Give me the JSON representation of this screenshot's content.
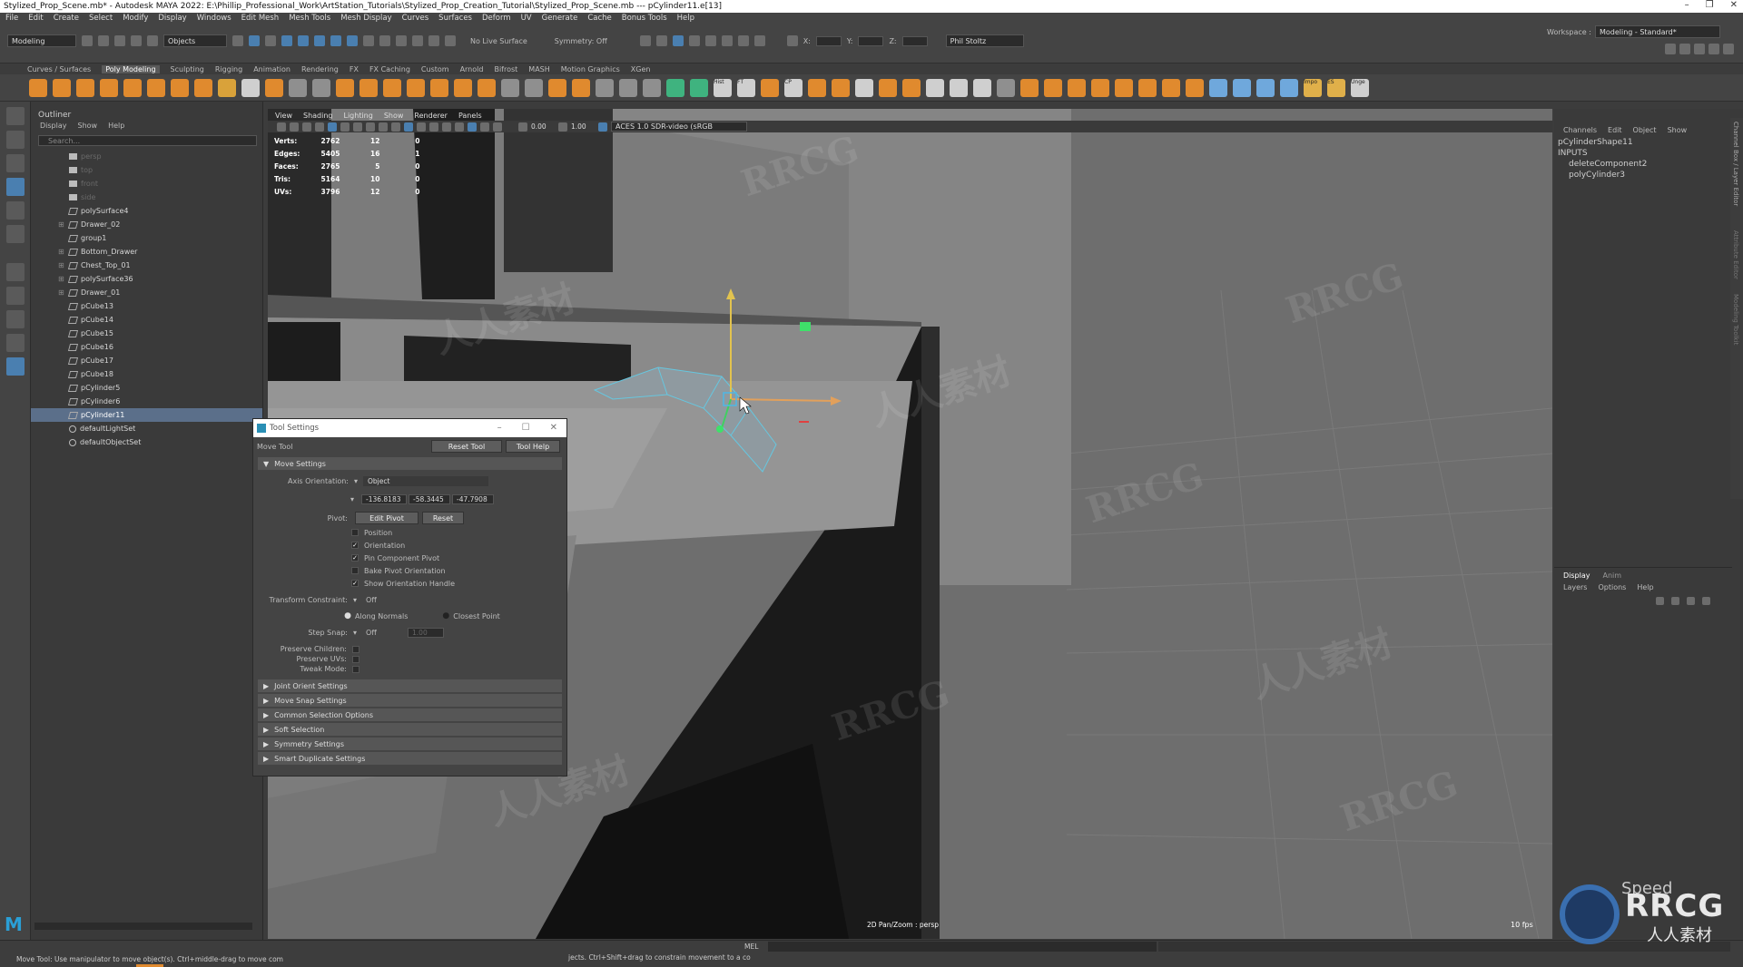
{
  "title_bar": {
    "text": "Stylized_Prop_Scene.mb* - Autodesk MAYA 2022: E:\\Phillip_Professional_Work\\ArtStation_Tutorials\\Stylized_Prop_Creation_Tutorial\\Stylized_Prop_Scene.mb  ---  pCylinder11.e[13]",
    "controls": [
      "–",
      "❐",
      "✕"
    ]
  },
  "menu_bar": [
    "File",
    "Edit",
    "Create",
    "Select",
    "Modify",
    "Display",
    "Windows",
    "Edit Mesh",
    "Mesh Tools",
    "Mesh Display",
    "Curves",
    "Surfaces",
    "Deform",
    "UV",
    "Generate",
    "Cache",
    "Bonus Tools",
    "Help"
  ],
  "status_line": {
    "mode": "Modeling",
    "select_mode": "Objects",
    "live_surface": "No Live Surface",
    "symmetry": "Symmetry: Off",
    "x_label": "X:",
    "y_label": "Y:",
    "z_label": "Z:",
    "user": "Phil Stoltz",
    "workspace_label": "Workspace :",
    "workspace": "Modeling - Standard*"
  },
  "shelf_tabs": [
    "Curves / Surfaces",
    "Poly Modeling",
    "Sculpting",
    "Rigging",
    "Animation",
    "Rendering",
    "FX",
    "FX Caching",
    "Custom",
    "Arnold",
    "Bifrost",
    "MASH",
    "Motion Graphics",
    "XGen"
  ],
  "shelf_active": "Poly Modeling",
  "shelf_icon_colors": [
    "#e08a2e",
    "#e08a2e",
    "#e08a2e",
    "#e08a2e",
    "#e08a2e",
    "#e08a2e",
    "#e08a2e",
    "#e08a2e",
    "#d9a23a",
    "#cfcfcf",
    "#e08a2e",
    "#8f8f8f",
    "#8f8f8f",
    "#e08a2e",
    "#e08a2e",
    "#e08a2e",
    "#e08a2e",
    "#e08a2e",
    "#e08a2e",
    "#e08a2e",
    "#8f8f8f",
    "#8f8f8f",
    "#e08a2e",
    "#e08a2e",
    "#8f8f8f",
    "#8f8f8f",
    "#8f8f8f",
    "#3fb37f",
    "#3fb37f",
    "#cfcfcf",
    "#cfcfcf",
    "#e08a2e",
    "#cfcfcf",
    "#e08a2e",
    "#e08a2e",
    "#cfcfcf",
    "#e08a2e",
    "#e08a2e",
    "#cfcfcf",
    "#cfcfcf",
    "#cfcfcf",
    "#8f8f8f",
    "#e08a2e",
    "#e08a2e",
    "#e08a2e",
    "#e08a2e",
    "#e08a2e",
    "#e08a2e",
    "#e08a2e",
    "#e08a2e",
    "#6fa8dc",
    "#6fa8dc",
    "#6fa8dc",
    "#6fa8dc",
    "#e0b04a",
    "#e0b04a",
    "#cfcfcf"
  ],
  "shelf_labels": {
    "hist": "Hist",
    "ft": "FT",
    "cp": "CP",
    "impo": "Impo",
    "es": "ES",
    "unge": "Unge"
  },
  "outliner": {
    "title": "Outliner",
    "menu": [
      "Display",
      "Show",
      "Help"
    ],
    "search_placeholder": "Search...",
    "items": [
      {
        "name": "persp",
        "kind": "cam",
        "dim": true
      },
      {
        "name": "top",
        "kind": "cam",
        "dim": true
      },
      {
        "name": "front",
        "kind": "cam",
        "dim": true
      },
      {
        "name": "side",
        "kind": "cam",
        "dim": true
      },
      {
        "name": "polySurface4",
        "kind": "mesh"
      },
      {
        "name": "Drawer_02",
        "kind": "mesh",
        "expand": true
      },
      {
        "name": "group1",
        "kind": "mesh"
      },
      {
        "name": "Bottom_Drawer",
        "kind": "mesh",
        "expand": true
      },
      {
        "name": "Chest_Top_01",
        "kind": "mesh",
        "expand": true
      },
      {
        "name": "polySurface36",
        "kind": "mesh",
        "expand": true
      },
      {
        "name": "Drawer_01",
        "kind": "mesh",
        "expand": true
      },
      {
        "name": "pCube13",
        "kind": "mesh"
      },
      {
        "name": "pCube14",
        "kind": "mesh"
      },
      {
        "name": "pCube15",
        "kind": "mesh"
      },
      {
        "name": "pCube16",
        "kind": "mesh"
      },
      {
        "name": "pCube17",
        "kind": "mesh"
      },
      {
        "name": "pCube18",
        "kind": "mesh"
      },
      {
        "name": "pCylinder5",
        "kind": "mesh"
      },
      {
        "name": "pCylinder6",
        "kind": "mesh"
      },
      {
        "name": "pCylinder11",
        "kind": "mesh",
        "selected": true
      },
      {
        "name": "defaultLightSet",
        "kind": "set"
      },
      {
        "name": "defaultObjectSet",
        "kind": "set"
      }
    ]
  },
  "viewport": {
    "menu": [
      "View",
      "Shading",
      "Lighting",
      "Show",
      "Renderer",
      "Panels"
    ],
    "exposure": "0.00",
    "gamma": "1.00",
    "color_space": "ACES 1.0 SDR-video (sRGB",
    "hud": [
      {
        "label": "Verts:",
        "a": "2762",
        "b": "12",
        "c": "0"
      },
      {
        "label": "Edges:",
        "a": "5405",
        "b": "16",
        "c": "1"
      },
      {
        "label": "Faces:",
        "a": "2765",
        "b": "5",
        "c": "0"
      },
      {
        "label": "Tris:",
        "a": "5164",
        "b": "10",
        "c": "0"
      },
      {
        "label": "UVs:",
        "a": "3796",
        "b": "12",
        "c": "0"
      }
    ],
    "camera_label": "2D Pan/Zoom : persp",
    "fps": "10 fps"
  },
  "tool_settings": {
    "window_title": "Tool Settings",
    "tool_name": "Move Tool",
    "reset_tool": "Reset Tool",
    "tool_help": "Tool Help",
    "section_move": "Move Settings",
    "axis_orientation_label": "Axis Orientation:",
    "axis_orientation_value": "Object",
    "orient_values": [
      "-136.8183",
      "-58.3445",
      "-47.7908"
    ],
    "pivot_label": "Pivot:",
    "edit_pivot": "Edit Pivot",
    "reset": "Reset",
    "checkboxes": [
      {
        "label": "Position",
        "checked": false
      },
      {
        "label": "Orientation",
        "checked": true
      },
      {
        "label": "Pin Component Pivot",
        "checked": true
      },
      {
        "label": "Bake Pivot Orientation",
        "checked": false
      },
      {
        "label": "Show Orientation Handle",
        "checked": true
      }
    ],
    "transform_constraint_label": "Transform Constraint:",
    "transform_constraint_value": "Off",
    "along_normals": "Along Normals",
    "closest_point": "Closest Point",
    "step_snap_label": "Step Snap:",
    "step_snap_value": "Off",
    "step_snap_amount": "1.00",
    "preserve_children": "Preserve Children:",
    "preserve_uvs": "Preserve UVs:",
    "tweak_mode": "Tweak Mode:",
    "collapsed_sections": [
      "Joint Orient Settings",
      "Move Snap Settings",
      "Common Selection Options",
      "Soft Selection",
      "Symmetry Settings",
      "Smart Duplicate Settings"
    ]
  },
  "channel_box": {
    "menu": [
      "Channels",
      "Edit",
      "Object",
      "Show"
    ],
    "shape": "pCylinderShape11",
    "inputs_label": "INPUTS",
    "inputs": [
      "deleteComponent2",
      "polyCylinder3"
    ],
    "layer_tabs": [
      "Display",
      "Anim"
    ],
    "layer_menu": [
      "Layers",
      "Options",
      "Help"
    ],
    "side_tabs": [
      "Channel Box / Layer Editor",
      "Attribute Editor",
      "Modeling Toolkit"
    ]
  },
  "command_line": {
    "mel": "MEL"
  },
  "help_line": {
    "text": "Move Tool: Use manipulator to move object(s). Ctrl+middle-drag to move com",
    "text2": "jects. Ctrl+Shift+drag to constrain movement to a co"
  },
  "watermark": {
    "text1": "RRCG",
    "text2": "人人素材"
  },
  "brand_logo": {
    "text": "RRCG",
    "subtext": "人人素材",
    "badge": "Speed"
  }
}
